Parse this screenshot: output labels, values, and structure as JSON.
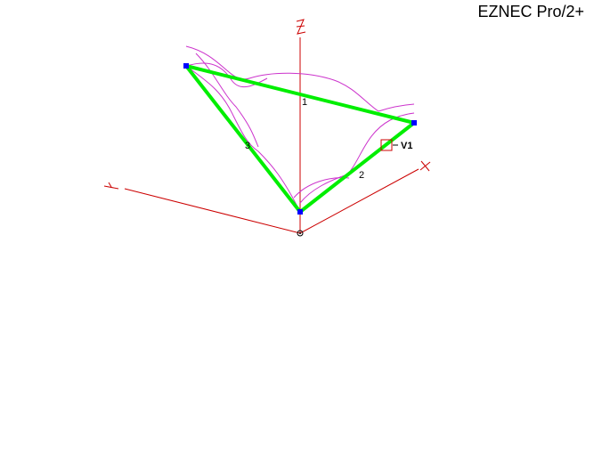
{
  "app": {
    "title": "EZNEC Pro/2+"
  },
  "axes": {
    "z_label": "Z",
    "y_label": "Y",
    "x_label": "X",
    "color": "#cc0000"
  },
  "antenna": {
    "wire_color": "#00ee00",
    "endpoint_color": "#0000ff",
    "pattern_color": "#cc33cc",
    "wire_labels": [
      "1",
      "2",
      "3"
    ],
    "source_label": "V1",
    "source_color": "#cc0000"
  }
}
